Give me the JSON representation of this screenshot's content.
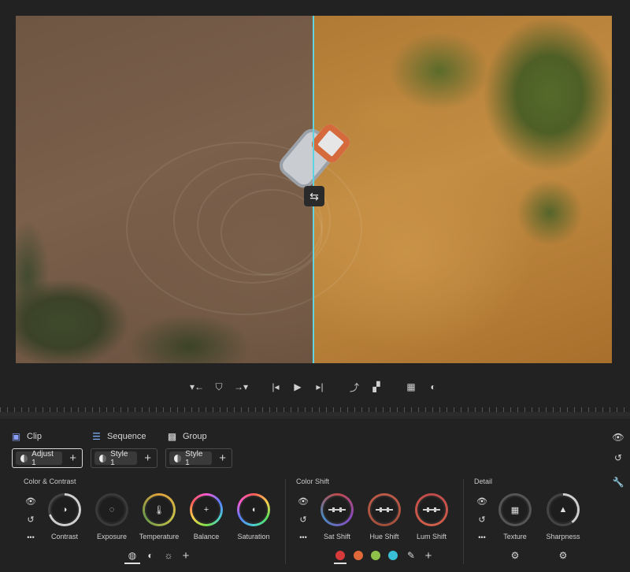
{
  "viewer": {
    "split_handle_icon": "swap-horizontal-icon",
    "divider_color": "#5fd3e0"
  },
  "transport": {
    "buttons": [
      {
        "name": "mark-in-icon",
        "glyph": "▾←"
      },
      {
        "name": "mark-clip-icon",
        "glyph": "⛉"
      },
      {
        "name": "mark-out-icon",
        "glyph": "→▾"
      },
      {
        "name": "go-to-start-icon",
        "glyph": "|◂"
      },
      {
        "name": "play-icon",
        "glyph": "▶"
      },
      {
        "name": "go-to-end-icon",
        "glyph": "▸|"
      },
      {
        "name": "export-frame-icon",
        "glyph": "⤴"
      },
      {
        "name": "safe-margins-icon",
        "glyph": "▞"
      },
      {
        "name": "compare-icon",
        "glyph": "▦"
      },
      {
        "name": "mask-icon",
        "glyph": "◐"
      }
    ]
  },
  "scopes": {
    "clip": {
      "label": "Clip",
      "icon": "clip-icon",
      "chip": "Adjust 1"
    },
    "sequence": {
      "label": "Sequence",
      "icon": "sequence-icon",
      "chip": "Style 1"
    },
    "group": {
      "label": "Group",
      "icon": "group-icon",
      "chip": "Style 1"
    },
    "add_glyph": "+"
  },
  "sections": {
    "color_contrast": {
      "title": "Color & Contrast",
      "knobs": [
        {
          "label": "Contrast",
          "glyph": "◑"
        },
        {
          "label": "Exposure",
          "glyph": "◌"
        },
        {
          "label": "Temperature",
          "glyph": "🌡"
        },
        {
          "label": "Balance",
          "glyph": "+"
        },
        {
          "label": "Saturation",
          "glyph": "◖"
        }
      ]
    },
    "color_shift": {
      "title": "Color Shift",
      "knobs": [
        {
          "label": "Sat Shift"
        },
        {
          "label": "Hue Shift"
        },
        {
          "label": "Lum Shift"
        }
      ]
    },
    "detail": {
      "title": "Detail",
      "knobs": [
        {
          "label": "Texture",
          "glyph": "▦"
        },
        {
          "label": "Sharpness",
          "glyph": "▲"
        }
      ]
    }
  },
  "side_icons": {
    "eye": "👁",
    "reset": "↺",
    "more": "•••"
  },
  "rail_icons": {
    "eye": "👁",
    "undo": "↺",
    "wrench": "🔧"
  },
  "bottom": {
    "cc_tabs": {
      "globe": "◍",
      "tone": "◐",
      "light": "☼",
      "add": "+"
    },
    "shift_swatches": [
      "#d63a3a",
      "#e0693a",
      "#8fc04a",
      "#3ac0d6"
    ],
    "shift_eyedropper": "✎",
    "shift_add": "+",
    "detail_tune": "⚙"
  }
}
